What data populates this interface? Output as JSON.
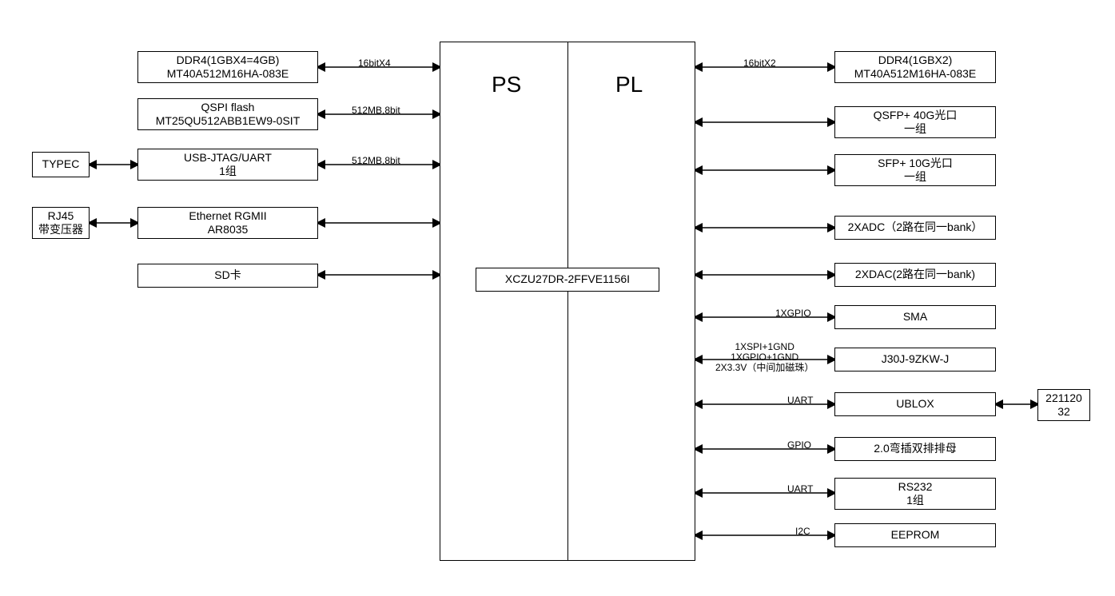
{
  "center": {
    "ps_label": "PS",
    "pl_label": "PL",
    "chip": "XCZU27DR-2FFVE1156I"
  },
  "left_far": {
    "typec": {
      "l1": "TYPEC"
    },
    "rj45": {
      "l1": "RJ45",
      "l2": "带变压器"
    }
  },
  "left": {
    "ddr4": {
      "l1": "DDR4(1GBX4=4GB)",
      "l2": "MT40A512M16HA-083E",
      "conn": "16bitX4"
    },
    "qspi": {
      "l1": "QSPI flash",
      "l2": "MT25QU512ABB1EW9-0SIT",
      "conn": "512MB,8bit"
    },
    "usb": {
      "l1": "USB-JTAG/UART",
      "l2": "1组",
      "conn": "512MB,8bit"
    },
    "eth": {
      "l1": "Ethernet RGMII",
      "l2": "AR8035"
    },
    "sd": {
      "l1": "SD卡"
    }
  },
  "right": {
    "ddr4": {
      "l1": "DDR4(1GBX2)",
      "l2": "MT40A512M16HA-083E",
      "conn": "16bitX2"
    },
    "qsfp": {
      "l1": "QSFP+ 40G光口",
      "l2": "一组"
    },
    "sfp": {
      "l1": "SFP+ 10G光口",
      "l2": "一组"
    },
    "xadc": {
      "l1": "2XADC（2路在同一bank）"
    },
    "xdac": {
      "l1": "2XDAC(2路在同一bank)"
    },
    "sma": {
      "l1": "SMA",
      "conn": "1XGPIO"
    },
    "j30j": {
      "l1": "J30J-9ZKW-J",
      "conn": "1XSPI+1GND\n1XGPIO+1GND\n2X3.3V（中间加磁珠）"
    },
    "ublox": {
      "l1": "UBLOX",
      "conn": "UART"
    },
    "header": {
      "l1": "2.0弯插双排排母",
      "conn": "GPIO"
    },
    "rs232": {
      "l1": "RS232",
      "l2": "1组",
      "conn": "UART"
    },
    "eeprom": {
      "l1": "EEPROM",
      "conn": "I2C"
    }
  },
  "right_far": {
    "ublox_ext": {
      "l1": "221120",
      "l2": "32"
    }
  }
}
